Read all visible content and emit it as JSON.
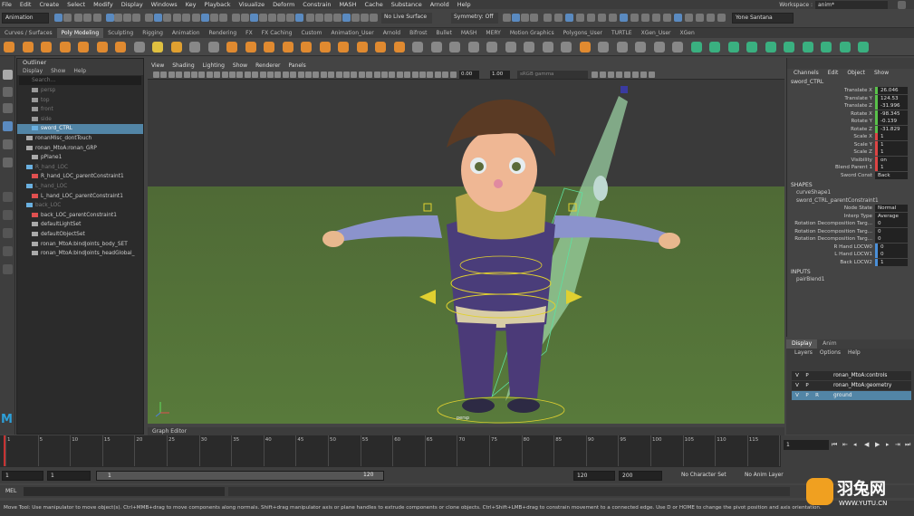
{
  "menus": [
    "File",
    "Edit",
    "Create",
    "Select",
    "Modify",
    "Display",
    "Windows",
    "Key",
    "Playback",
    "Visualize",
    "Deform",
    "Constrain",
    "MASH",
    "Cache",
    "Substance",
    "Arnold",
    "Help"
  ],
  "workspace": {
    "label": "Workspace :",
    "value": "anim*"
  },
  "status": {
    "menuset": "Animation",
    "live": "No Live Surface",
    "symmetry": "Symmetry: Off",
    "user": "Yone Santana"
  },
  "shelf_tabs": [
    "Curves / Surfaces",
    "Poly Modeling",
    "Sculpting",
    "Rigging",
    "Animation",
    "Rendering",
    "FX",
    "FX Caching",
    "Custom",
    "Animation_User",
    "Arnold",
    "Bifrost",
    "Bullet",
    "MASH",
    "MERY",
    "Motion Graphics",
    "Polygons_User",
    "TURTLE",
    "XGen_User",
    "XGen"
  ],
  "shelf_active": "Poly Modeling",
  "outliner": {
    "title": "Outliner",
    "menu": [
      "Display",
      "Show",
      "Help"
    ],
    "search": "Search...",
    "items": [
      {
        "label": "persp",
        "style": "dim",
        "icon": "camera-icon"
      },
      {
        "label": "top",
        "style": "dim",
        "icon": "camera-icon"
      },
      {
        "label": "front",
        "style": "dim",
        "icon": "camera-icon"
      },
      {
        "label": "side",
        "style": "dim",
        "icon": "camera-icon"
      },
      {
        "label": "sword_CTRL",
        "style": "sel",
        "icon": "curve-icon"
      },
      {
        "label": "ronanMisc_dontTouch",
        "style": "",
        "icon": "group-icon"
      },
      {
        "label": "ronan_MtoA:ronan_GRP",
        "style": "",
        "icon": "group-icon"
      },
      {
        "label": "pPlane1",
        "style": "",
        "icon": "mesh-icon"
      },
      {
        "label": "R_hand_LOC",
        "style": "dim",
        "icon": "locator-icon"
      },
      {
        "label": "R_hand_LOC_parentConstraint1",
        "style": "",
        "icon": "constraint-icon"
      },
      {
        "label": "L_hand_LOC",
        "style": "dim",
        "icon": "locator-icon"
      },
      {
        "label": "L_hand_LOC_parentConstraint1",
        "style": "",
        "icon": "constraint-icon"
      },
      {
        "label": "back_LOC",
        "style": "dim",
        "icon": "locator-icon"
      },
      {
        "label": "back_LOC_parentConstraint1",
        "style": "",
        "icon": "constraint-icon"
      },
      {
        "label": "defaultLightSet",
        "style": "",
        "icon": "set-icon"
      },
      {
        "label": "defaultObjectSet",
        "style": "",
        "icon": "set-icon"
      },
      {
        "label": "ronan_MtoA:bindJoints_body_SET",
        "style": "",
        "icon": "set-icon"
      },
      {
        "label": "ronan_MtoA:bindJoints_headGlobal_",
        "style": "",
        "icon": "set-icon"
      }
    ]
  },
  "viewport": {
    "menu": [
      "View",
      "Shading",
      "Lighting",
      "Show",
      "Renderer",
      "Panels"
    ],
    "field1": "0.00",
    "field2": "1.00",
    "colorspace": "sRGB gamma",
    "cam_label": "persp"
  },
  "graph_editor_tab": "Graph Editor",
  "channel_box": {
    "menu": [
      "Channels",
      "Edit",
      "Object",
      "Show"
    ],
    "object": "sword_CTRL",
    "attrs": [
      {
        "name": "Translate X",
        "value": "26.046",
        "key": "gr"
      },
      {
        "name": "Translate Y",
        "value": "124.53",
        "key": "gr"
      },
      {
        "name": "Translate Z",
        "value": "-31.996",
        "key": "gr"
      },
      {
        "name": "Rotate X",
        "value": "-98.345",
        "key": "gr"
      },
      {
        "name": "Rotate Y",
        "value": "-0.139",
        "key": "gr"
      },
      {
        "name": "Rotate Z",
        "value": "-31.829",
        "key": "gr"
      },
      {
        "name": "Scale X",
        "value": "1",
        "key": "k"
      },
      {
        "name": "Scale Y",
        "value": "1",
        "key": "k"
      },
      {
        "name": "Scale Z",
        "value": "1",
        "key": "k"
      },
      {
        "name": "Visibility",
        "value": "on",
        "key": "k"
      },
      {
        "name": "Blend Parent 1",
        "value": "1",
        "key": "k"
      },
      {
        "name": "Sword Const",
        "value": "Back",
        "key": ""
      }
    ],
    "shapes_title": "SHAPES",
    "shapes": [
      "curveShape1",
      "sword_CTRL_parentConstraint1"
    ],
    "shape_attrs": [
      {
        "name": "Node State",
        "value": "Normal",
        "key": ""
      },
      {
        "name": "Interp Type",
        "value": "Average",
        "key": ""
      },
      {
        "name": "Rotation Decomposition Targ...",
        "value": "0",
        "key": ""
      },
      {
        "name": "Rotation Decomposition Targ...",
        "value": "0",
        "key": ""
      },
      {
        "name": "Rotation Decomposition Targ...",
        "value": "0",
        "key": ""
      },
      {
        "name": "R Hand LOCW0",
        "value": "0",
        "key": "bl"
      },
      {
        "name": "L Hand LOCW1",
        "value": "0",
        "key": "bl"
      },
      {
        "name": "Back LOCW2",
        "value": "1",
        "key": "bl"
      }
    ],
    "inputs_title": "INPUTS",
    "inputs": [
      "pairBlend1"
    ]
  },
  "layers": {
    "tabs": [
      "Display",
      "Anim"
    ],
    "menu": [
      "Layers",
      "Options",
      "Help"
    ],
    "rows": [
      {
        "v": "V",
        "p": "P",
        "r": "",
        "name": "ronan_MtoA:controls",
        "sel": false
      },
      {
        "v": "V",
        "p": "P",
        "r": "",
        "name": "ronan_MtoA:geometry",
        "sel": false
      },
      {
        "v": "V",
        "p": "P",
        "r": "R",
        "name": "ground",
        "sel": true
      }
    ]
  },
  "timeline": {
    "ticks": [
      "1",
      "5",
      "10",
      "15",
      "20",
      "25",
      "30",
      "35",
      "40",
      "45",
      "50",
      "55",
      "60",
      "65",
      "70",
      "75",
      "80",
      "85",
      "90",
      "95",
      "100",
      "105",
      "110",
      "115",
      "120"
    ],
    "current": "1"
  },
  "range": {
    "start": "1",
    "start2": "1",
    "slider_start": "1",
    "slider_end": "120",
    "end": "120",
    "end2": "200",
    "char_set": "No Character Set",
    "anim_layer": "No Anim Layer"
  },
  "mel_label": "MEL",
  "help_text": "Move Tool: Use manipulator to move object(s). Ctrl+MMB+drag to move components along normals. Shift+drag manipulator axis or plane handles to extrude components or clone objects. Ctrl+Shift+LMB+drag to constrain movement to a connected edge. Use D or HOME to change the pivot position and axis orientation.",
  "watermark": {
    "brand": "羽兔网",
    "url": "WWW.YUTU.CN"
  }
}
